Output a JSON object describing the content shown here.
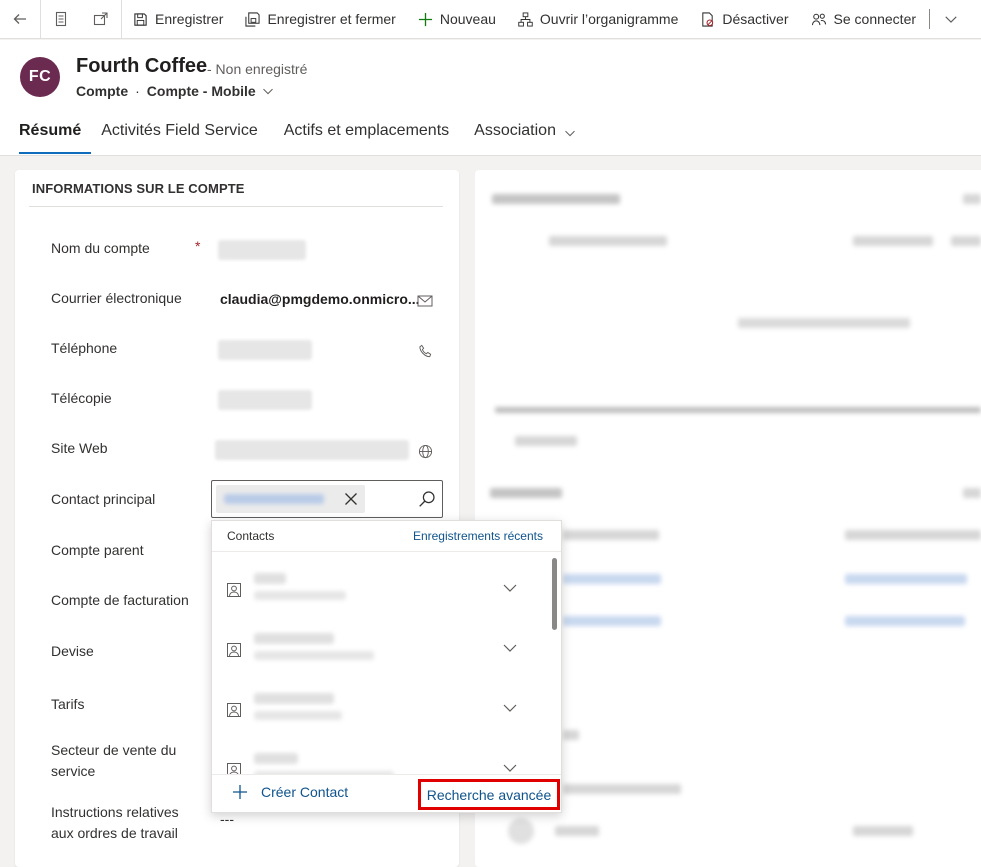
{
  "command_bar": {
    "save_label": "Enregistrer",
    "save_close_label": "Enregistrer et fermer",
    "new_label": "Nouveau",
    "org_chart_label": "Ouvrir l’organigramme",
    "deactivate_label": "Désactiver",
    "connect_label": "Se connecter"
  },
  "header": {
    "avatar_initials": "FC",
    "avatar_color": "#6b2a50",
    "title": "Fourth Coffee",
    "status": "- Non enregistré",
    "entity": "Compte",
    "separator": "·",
    "form": "Compte - Mobile"
  },
  "tabs": [
    {
      "label": "Résumé",
      "active": true
    },
    {
      "label": "Activités Field Service"
    },
    {
      "label": "Actifs et emplacements"
    },
    {
      "label": "Association"
    }
  ],
  "section": {
    "title": "INFORMATIONS SUR LE COMPTE",
    "fields": [
      {
        "label": "Nom du compte",
        "required": "*"
      },
      {
        "label": "Courrier électronique",
        "value": "claudia@pmgdemo.onmicro..."
      },
      {
        "label": "Téléphone"
      },
      {
        "label": "Télécopie"
      },
      {
        "label": "Site Web"
      },
      {
        "label": "Contact principal"
      },
      {
        "label": "Compte parent"
      },
      {
        "label": "Compte de facturation"
      },
      {
        "label": "Devise"
      },
      {
        "label": "Tarifs"
      },
      {
        "label": "Secteur de vente du service"
      },
      {
        "label": "Instructions relatives aux ordres de travail",
        "value": "---"
      }
    ]
  },
  "lookup_dropdown": {
    "header_left": "Contacts",
    "header_right": "Enregistrements récents",
    "create_label": "Créer Contact",
    "advanced_search_label": "Recherche avancée",
    "highlight_color": "#e00000"
  },
  "colors": {
    "accent": "#0f6cbd",
    "link": "#0f548c",
    "required": "#a4262c"
  }
}
